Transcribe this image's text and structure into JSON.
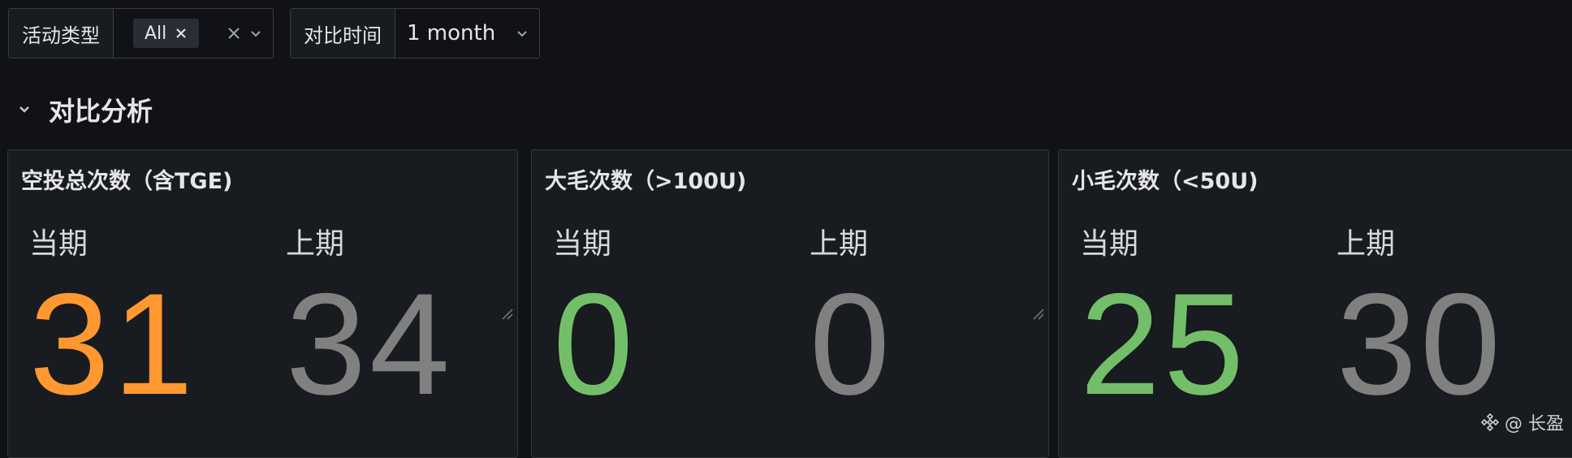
{
  "variables": [
    {
      "label": "活动类型",
      "chip": "All"
    },
    {
      "label": "对比时间",
      "value": "1 month"
    }
  ],
  "row": {
    "title": "对比分析"
  },
  "panels": [
    {
      "title": "空投总次数（含TGE)",
      "current_label": "当期",
      "current_value": "31",
      "current_color": "#ff9830",
      "previous_label": "上期",
      "previous_value": "34",
      "previous_color": "#808080"
    },
    {
      "title": "大毛次数（>100U)",
      "current_label": "当期",
      "current_value": "0",
      "current_color": "#73bf69",
      "previous_label": "上期",
      "previous_value": "0",
      "previous_color": "#808080"
    },
    {
      "title": "小毛次数（<50U)",
      "current_label": "当期",
      "current_value": "25",
      "current_color": "#73bf69",
      "previous_label": "上期",
      "previous_value": "30",
      "previous_color": "#808080"
    }
  ],
  "watermark": {
    "text": "@ 长盈",
    "icon": "binance-logo-icon"
  },
  "icons": {
    "remove": "close-icon",
    "clear": "clear-icon",
    "dropdown": "chevron-down-icon",
    "collapse": "chevron-down-icon",
    "resize": "resize-handle-icon"
  }
}
